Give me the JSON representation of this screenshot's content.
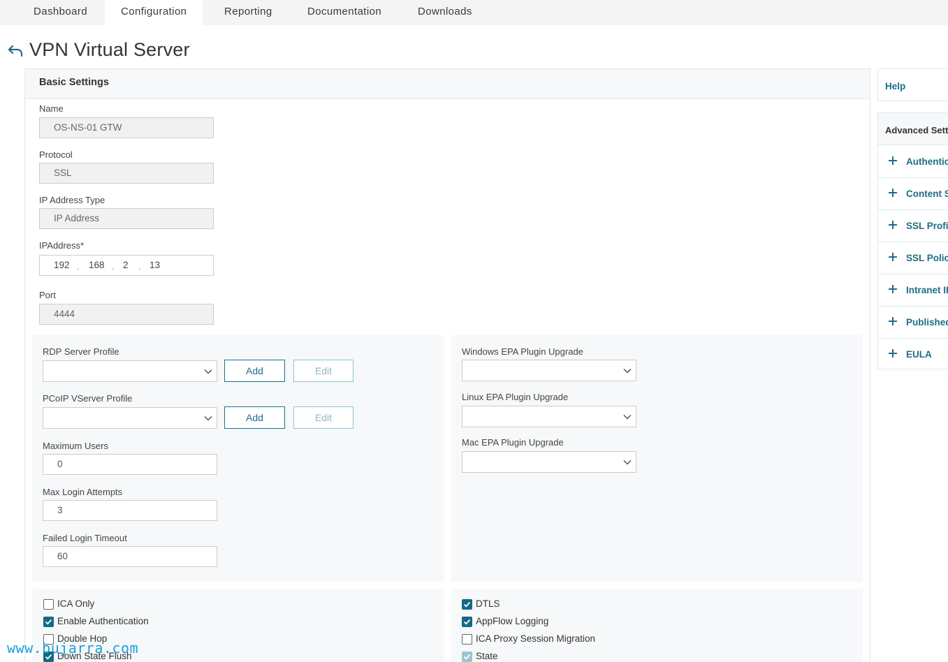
{
  "nav": {
    "tabs": [
      {
        "label": "Dashboard"
      },
      {
        "label": "Configuration"
      },
      {
        "label": "Reporting"
      },
      {
        "label": "Documentation"
      },
      {
        "label": "Downloads"
      }
    ],
    "active": "Configuration"
  },
  "page": {
    "title": "VPN Virtual Server",
    "back_icon": "back-arrow-icon"
  },
  "basic": {
    "header": "Basic Settings",
    "name_label": "Name",
    "name_value": "OS-NS-01 GTW",
    "protocol_label": "Protocol",
    "protocol_value": "SSL",
    "ip_type_label": "IP Address Type",
    "ip_type_value": "IP Address",
    "ip_label": "IPAddress*",
    "ip": [
      "192",
      "168",
      "2",
      "13"
    ],
    "ip_sep": ".",
    "port_label": "Port",
    "port_value": "4444"
  },
  "left_sub": {
    "rdp_label": "RDP Server Profile",
    "pcoip_label": "PCoIP VServer Profile",
    "add_label": "Add",
    "edit_label": "Edit",
    "max_users_label": "Maximum Users",
    "max_users_value": "0",
    "max_login_label": "Max Login Attempts",
    "max_login_value": "3",
    "failed_timeout_label": "Failed Login Timeout",
    "failed_timeout_value": "60"
  },
  "right_sub": {
    "windows_label": "Windows EPA Plugin Upgrade",
    "linux_label": "Linux EPA Plugin Upgrade",
    "mac_label": "Mac EPA Plugin Upgrade"
  },
  "checks_left": [
    {
      "label": "ICA Only",
      "checked": false
    },
    {
      "label": "Enable Authentication",
      "checked": true
    },
    {
      "label": "Double Hop",
      "checked": false
    },
    {
      "label": "Down State Flush",
      "checked": true
    }
  ],
  "checks_right": [
    {
      "label": "DTLS",
      "checked": true
    },
    {
      "label": "AppFlow Logging",
      "checked": true
    },
    {
      "label": "ICA Proxy Session Migration",
      "checked": false
    },
    {
      "label": "State",
      "checked": true,
      "disabled": true
    }
  ],
  "sidebar": {
    "help": "Help",
    "advanced_header": "Advanced Settin",
    "items": [
      {
        "label": "Authentica"
      },
      {
        "label": "Content Sv"
      },
      {
        "label": "SSL Profile"
      },
      {
        "label": "SSL Policie"
      },
      {
        "label": "Intranet IP"
      },
      {
        "label": "Published"
      },
      {
        "label": "EULA"
      }
    ]
  },
  "watermark": "www.bujarra.com",
  "colors": {
    "accent": "#1d6e86",
    "checkbox": "#126a84",
    "panel_bg": "#f6f8fa"
  }
}
